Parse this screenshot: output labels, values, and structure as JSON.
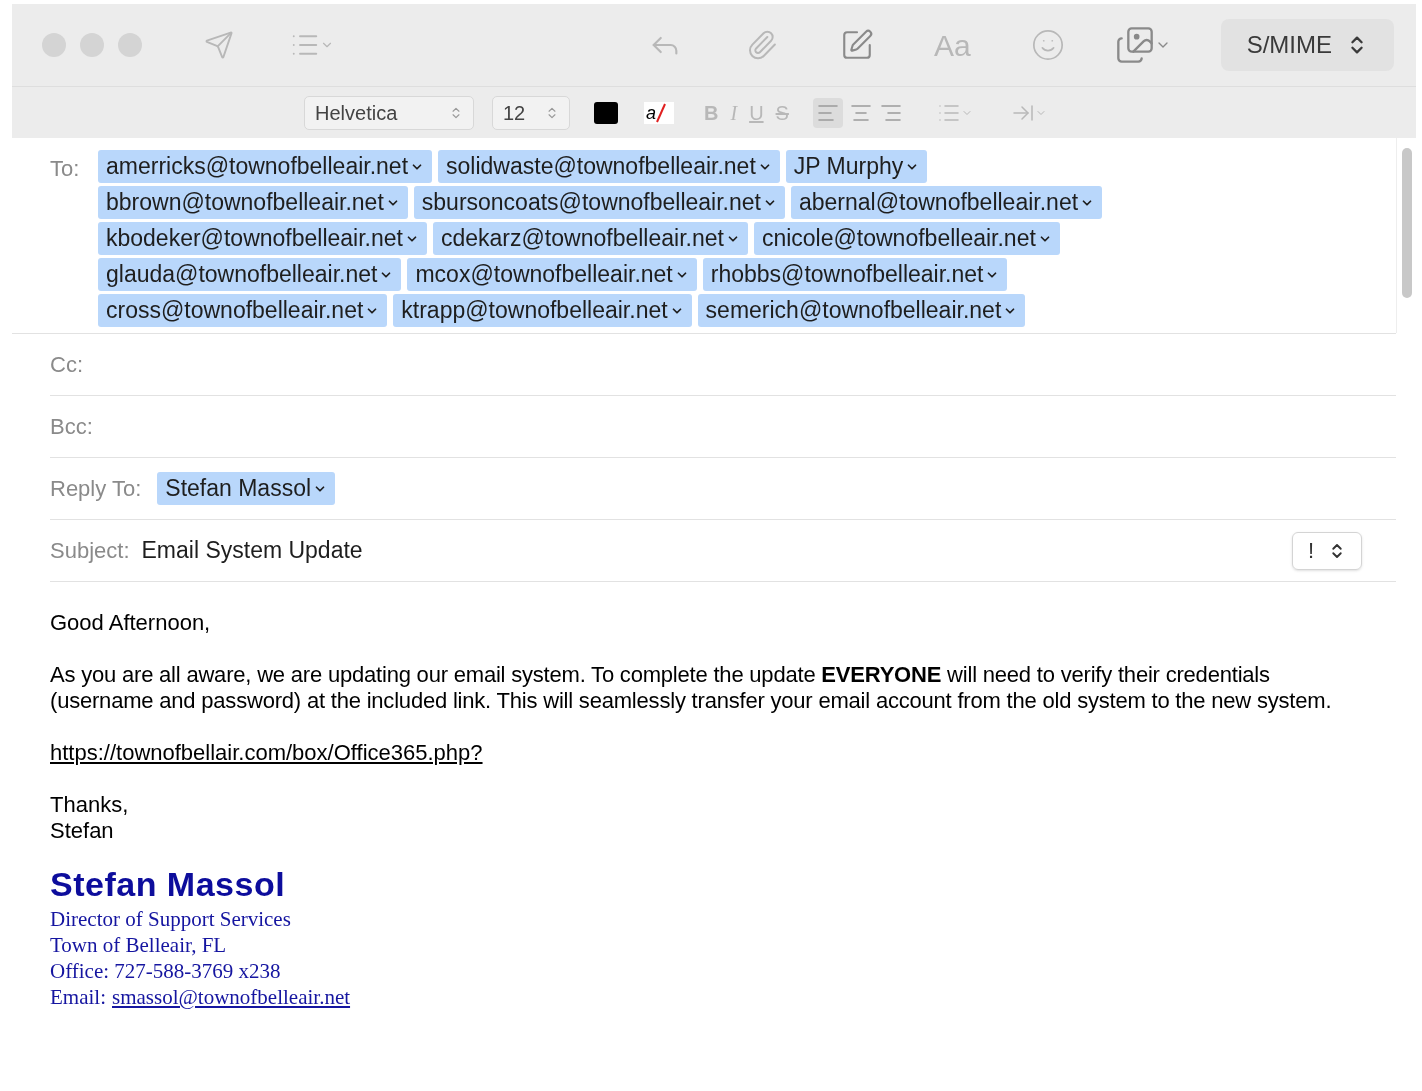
{
  "toolbar": {
    "smime": "S/MIME",
    "font_button": "Aa"
  },
  "format_bar": {
    "font": "Helvetica",
    "size": "12",
    "highlight_glyph": "a",
    "bold": "B",
    "italic": "I",
    "underline": "U",
    "strike": "S"
  },
  "to": {
    "label": "To:",
    "recipients": [
      {
        "name": "amerricks@townofbelleair.net"
      },
      {
        "name": "solidwaste@townofbelleair.net"
      },
      {
        "name": "JP Murphy"
      },
      {
        "name": "bbrown@townofbelleair.net"
      },
      {
        "name": "sbursoncoats@townofbelleair.net"
      },
      {
        "name": "abernal@townofbelleair.net"
      },
      {
        "name": "kbodeker@townofbelleair.net"
      },
      {
        "name": "cdekarz@townofbelleair.net"
      },
      {
        "name": "cnicole@townofbelleair.net"
      },
      {
        "name": "glauda@townofbelleair.net"
      },
      {
        "name": "mcox@townofbelleair.net"
      },
      {
        "name": "rhobbs@townofbelleair.net"
      },
      {
        "name": "cross@townofbelleair.net"
      },
      {
        "name": "ktrapp@townofbelleair.net"
      },
      {
        "name": "semerich@townofbelleair.net"
      }
    ]
  },
  "cc": {
    "label": "Cc:"
  },
  "bcc": {
    "label": "Bcc:"
  },
  "reply_to": {
    "label": "Reply To:",
    "recipients": [
      {
        "name": "Stefan Massol"
      }
    ]
  },
  "subject": {
    "label": "Subject:",
    "value": "Email System Update",
    "priority": "!"
  },
  "body": {
    "greeting": "Good Afternoon,",
    "paragraph": "As you are all aware, we are updating our email system. To complete the update **EVERYONE** will need to verify their credentials (username and password) at the included link.  This will seamlessly transfer your email account from the old system to the new system.",
    "link": "https://townofbellair.com/box/Office365.php?",
    "closing": [
      "Thanks,",
      "Stefan"
    ],
    "signature": {
      "name": "Stefan Massol",
      "lines": [
        "Director of Support Services",
        "Town of Belleair, FL",
        "Office: 727-588-3769 x238"
      ],
      "email_label": "Email:",
      "email": "smassol@townofbelleair.net"
    }
  }
}
